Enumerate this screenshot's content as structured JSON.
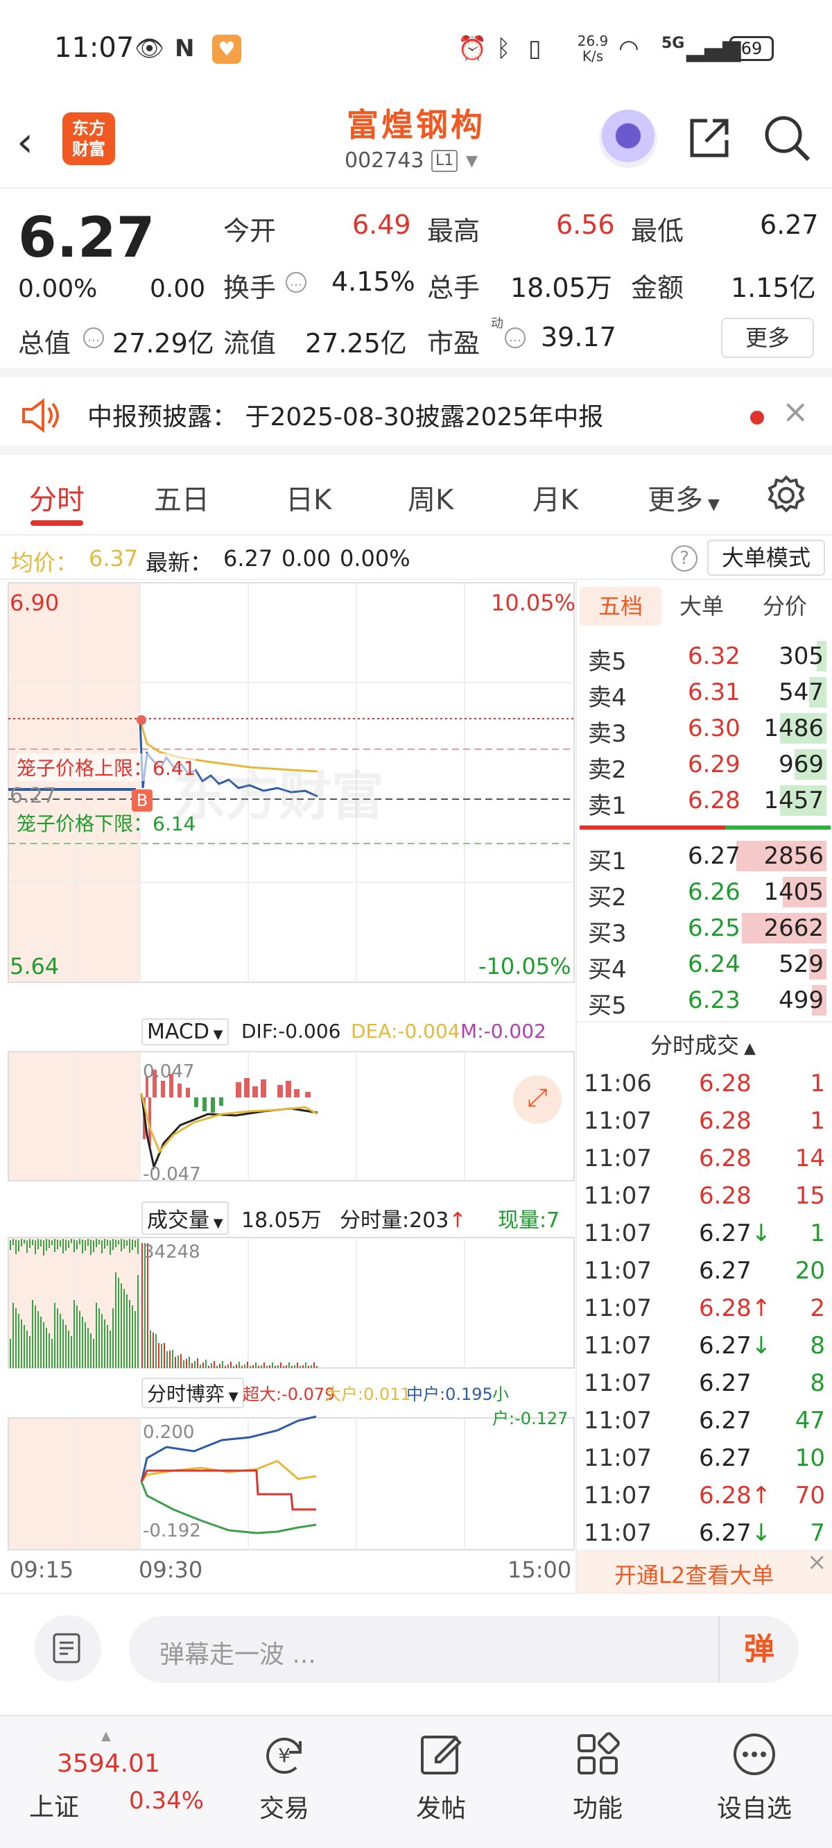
{
  "status": {
    "time": "11:07",
    "net_speed": "26.9\nK/s",
    "net_speed_line1": "26.9",
    "net_speed_line2": "K/s",
    "network": "5G",
    "battery": "69"
  },
  "header": {
    "stock_name": "富煌钢构",
    "stock_code": "002743",
    "level": "L1",
    "logo_line1": "东方",
    "logo_line2": "财富"
  },
  "quote": {
    "price": "6.27",
    "change_pct": "0.00%",
    "change": "0.00",
    "fields": [
      {
        "label": "今开",
        "value": "6.49",
        "color": "red"
      },
      {
        "label": "最高",
        "value": "6.56",
        "color": "red"
      },
      {
        "label": "最低",
        "value": "6.27",
        "color": "black"
      },
      {
        "label": "换手",
        "value": "4.15%",
        "color": "black"
      },
      {
        "label": "总手",
        "value": "18.05万",
        "color": "black"
      },
      {
        "label": "金额",
        "value": "1.15亿",
        "color": "black"
      },
      {
        "label": "总值",
        "value": "27.29亿",
        "color": "black"
      },
      {
        "label": "流值",
        "value": "27.25亿",
        "color": "black"
      },
      {
        "label": "市盈",
        "value": "39.17",
        "color": "black"
      }
    ],
    "pe_super": "动",
    "more_label": "更多"
  },
  "notice": {
    "text": "中报预披露： 于2025-08-30披露2025年中报"
  },
  "tabs": [
    "分时",
    "五日",
    "日K",
    "周K",
    "月K",
    "更多"
  ],
  "avg_bar": {
    "avg_label": "均价：",
    "avg_value": "6.37",
    "latest_label": "最新：",
    "latest_value": "6.27",
    "latest_change": "0.00",
    "latest_pct": "0.00%",
    "mode_button": "大单模式"
  },
  "price_chart": {
    "top_left": "6.90",
    "bottom_left": "5.64",
    "top_right": "10.05%",
    "bottom_right": "-10.05%",
    "mid_left": "6.27",
    "upper_cage": "笼子价格上限：6.41",
    "lower_cage": "笼子价格下限：6.14",
    "b_marker": "B",
    "watermark": "东方财富"
  },
  "macd": {
    "label": "MACD",
    "dif": "DIF:-0.006",
    "dea": "DEA:-0.004",
    "m": "M:-0.002",
    "top": "0.047",
    "bottom": "-0.047"
  },
  "volume": {
    "label": "成交量",
    "total": "18.05万",
    "minute_vol": "分时量:203",
    "now_vol": "现量:7",
    "max": "34248"
  },
  "game": {
    "label": "分时博弈",
    "super": "超大:-0.079",
    "big": "大户:0.011",
    "mid": "中户:0.195",
    "small": "小户:-0.127",
    "top": "0.200",
    "bottom": "-0.192"
  },
  "time_axis": [
    "09:15",
    "09:30",
    "15:00"
  ],
  "order_book": {
    "tabs": [
      "五档",
      "大单",
      "分价"
    ],
    "asks": [
      {
        "label": "卖5",
        "price": "6.32",
        "vol": "305",
        "bar": 0.04
      },
      {
        "label": "卖4",
        "price": "6.31",
        "vol": "547",
        "bar": 0.07
      },
      {
        "label": "卖3",
        "price": "6.30",
        "vol": "1486",
        "bar": 0.19
      },
      {
        "label": "卖2",
        "price": "6.29",
        "vol": "969",
        "bar": 0.13
      },
      {
        "label": "卖1",
        "price": "6.28",
        "vol": "1457",
        "bar": 0.19
      }
    ],
    "bids": [
      {
        "label": "买1",
        "price": "6.27",
        "vol": "2856",
        "bar": 0.37
      },
      {
        "label": "买2",
        "price": "6.26",
        "vol": "1405",
        "bar": 0.18
      },
      {
        "label": "买3",
        "price": "6.25",
        "vol": "2662",
        "bar": 0.35
      },
      {
        "label": "买4",
        "price": "6.24",
        "vol": "529",
        "bar": 0.07
      },
      {
        "label": "买5",
        "price": "6.23",
        "vol": "499",
        "bar": 0.06
      }
    ]
  },
  "trades": {
    "title": "分时成交",
    "rows": [
      {
        "time": "11:06",
        "price": "6.28",
        "dir": "",
        "vol": "1",
        "pcolor": "red",
        "vcolor": "red"
      },
      {
        "time": "11:07",
        "price": "6.28",
        "dir": "",
        "vol": "1",
        "pcolor": "red",
        "vcolor": "red"
      },
      {
        "time": "11:07",
        "price": "6.28",
        "dir": "",
        "vol": "14",
        "pcolor": "red",
        "vcolor": "red"
      },
      {
        "time": "11:07",
        "price": "6.28",
        "dir": "",
        "vol": "15",
        "pcolor": "red",
        "vcolor": "red"
      },
      {
        "time": "11:07",
        "price": "6.27",
        "dir": "↓",
        "vol": "1",
        "pcolor": "black",
        "vcolor": "green"
      },
      {
        "time": "11:07",
        "price": "6.27",
        "dir": "",
        "vol": "20",
        "pcolor": "black",
        "vcolor": "green"
      },
      {
        "time": "11:07",
        "price": "6.28",
        "dir": "↑",
        "vol": "2",
        "pcolor": "red",
        "vcolor": "red"
      },
      {
        "time": "11:07",
        "price": "6.27",
        "dir": "↓",
        "vol": "8",
        "pcolor": "black",
        "vcolor": "green"
      },
      {
        "time": "11:07",
        "price": "6.27",
        "dir": "",
        "vol": "8",
        "pcolor": "black",
        "vcolor": "green"
      },
      {
        "time": "11:07",
        "price": "6.27",
        "dir": "",
        "vol": "47",
        "pcolor": "black",
        "vcolor": "green"
      },
      {
        "time": "11:07",
        "price": "6.27",
        "dir": "",
        "vol": "10",
        "pcolor": "black",
        "vcolor": "green"
      },
      {
        "time": "11:07",
        "price": "6.28",
        "dir": "↑",
        "vol": "70",
        "pcolor": "red",
        "vcolor": "red"
      },
      {
        "time": "11:07",
        "price": "6.27",
        "dir": "↓",
        "vol": "7",
        "pcolor": "black",
        "vcolor": "green"
      }
    ],
    "l2_banner": "开通L2查看大单"
  },
  "comment": {
    "placeholder": "弹幕走一波 ...",
    "danmu_button": "弹"
  },
  "bottom_nav": {
    "index_value": "3594.01",
    "index_name": "上证",
    "index_pct": "0.34%",
    "items": [
      "交易",
      "发帖",
      "功能",
      "设自选"
    ]
  },
  "colors": {
    "brand": "#f05a22",
    "up": "#e0332c",
    "down": "#1d9e2c",
    "avg_line": "#e6b83a"
  }
}
